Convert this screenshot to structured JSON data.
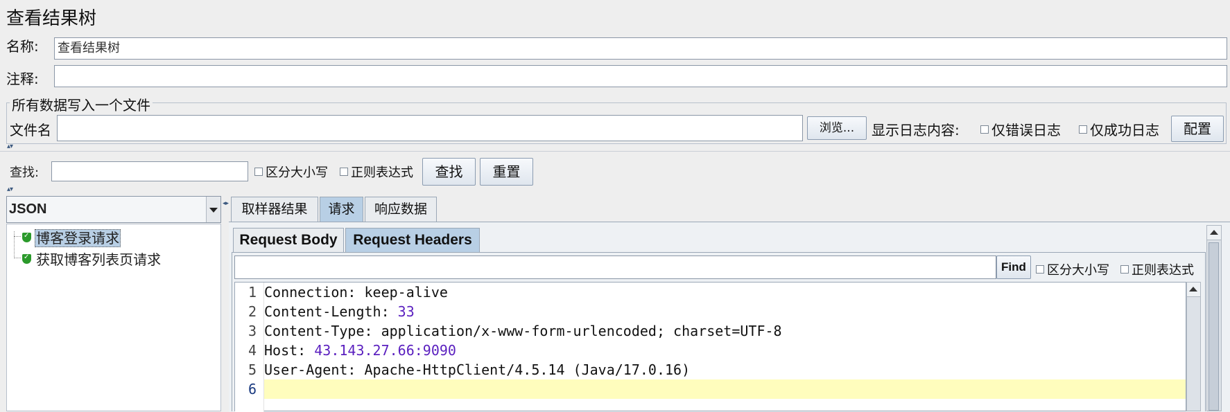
{
  "page_title": "查看结果树",
  "name_label": "名称:",
  "name_value": "查看结果树",
  "comment_label": "注释:",
  "comment_value": "",
  "file_group_label": "所有数据写入一个文件",
  "file_label": "文件名",
  "file_value": "",
  "browse_button": "浏览...",
  "log_content_label": "显示日志内容:",
  "errors_only_label": "仅错误日志",
  "success_only_label": "仅成功日志",
  "config_button": "配置",
  "search": {
    "label": "查找:",
    "value": "",
    "case_sensitive_label": "区分大小写",
    "regex_label": "正则表达式",
    "find_button": "查找",
    "reset_button": "重置"
  },
  "renderer_select": "JSON",
  "tree": {
    "items": [
      {
        "label": "博客登录请求",
        "selected": true,
        "status_icon": "success-shield-icon"
      },
      {
        "label": "获取博客列表页请求",
        "selected": false,
        "status_icon": "success-shield-icon"
      }
    ]
  },
  "tabs": [
    {
      "label": "取样器结果",
      "selected": false
    },
    {
      "label": "请求",
      "selected": true
    },
    {
      "label": "响应数据",
      "selected": false
    }
  ],
  "subtabs": [
    {
      "label": "Request Body",
      "selected": false
    },
    {
      "label": "Request Headers",
      "selected": true
    }
  ],
  "find_bar": {
    "value": "",
    "find_button": "Find",
    "case_sensitive_label": "区分大小写",
    "regex_label": "正则表达式"
  },
  "editor": {
    "line_numbers": [
      "1",
      "2",
      "3",
      "4",
      "5",
      "6"
    ],
    "lines": [
      {
        "key": "Connection",
        "sep": ": ",
        "value": "keep-alive"
      },
      {
        "key": "Content-Length",
        "sep": ": ",
        "value": "33"
      },
      {
        "key": "Content-Type",
        "sep": ": ",
        "value": "application/x-www-form-urlencoded; charset=UTF-8"
      },
      {
        "key": "Host",
        "sep": ": ",
        "value": "43.143.27.66:9090"
      },
      {
        "key": "User-Agent",
        "sep": ": ",
        "value": "Apache-HttpClient/4.5.14 (Java/17.0.16)"
      }
    ],
    "current_line": "6",
    "current_line_color": "#fffdbd"
  },
  "colors": {
    "selected_tab": "#b8cfe5",
    "value_purple": "#5a1fbf",
    "paren_red": "#c00000",
    "success_green": "#2b9a2b"
  }
}
